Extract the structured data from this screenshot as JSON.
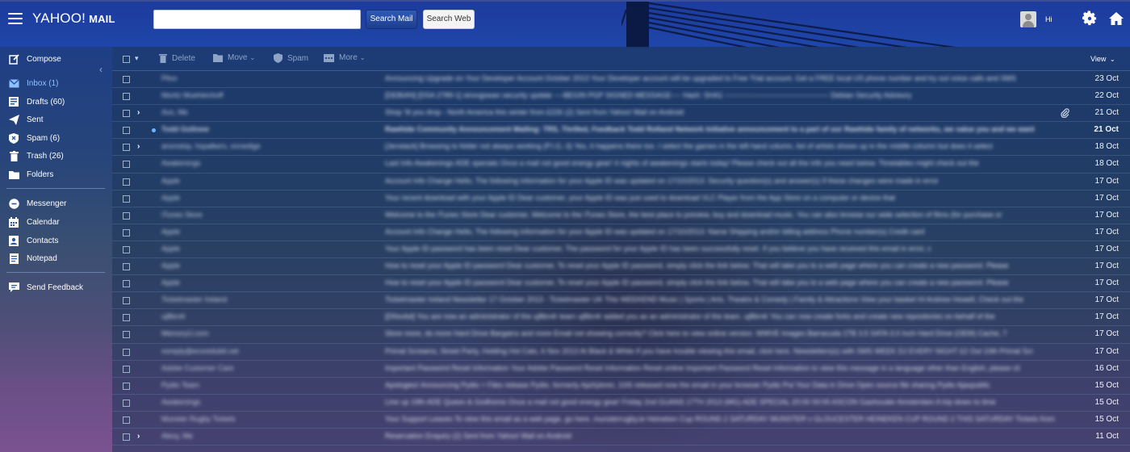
{
  "header": {
    "logo_main": "YAHOO!",
    "logo_sub": "MAIL",
    "search_value": "",
    "search_mail_label": "Search Mail",
    "search_web_label": "Search Web",
    "greeting": "Hi"
  },
  "sidebar": {
    "items": [
      {
        "label": "Compose",
        "icon": "compose-icon"
      },
      {
        "label": "Inbox (1)",
        "icon": "inbox-icon"
      },
      {
        "label": "Drafts (60)",
        "icon": "drafts-icon"
      },
      {
        "label": "Sent",
        "icon": "sent-icon"
      },
      {
        "label": "Spam (6)",
        "icon": "spam-icon"
      },
      {
        "label": "Trash (26)",
        "icon": "trash-icon"
      },
      {
        "label": "Folders",
        "icon": "folder-icon"
      },
      {
        "label": "Messenger",
        "icon": "messenger-icon"
      },
      {
        "label": "Calendar",
        "icon": "calendar-icon"
      },
      {
        "label": "Contacts",
        "icon": "contacts-icon"
      },
      {
        "label": "Notepad",
        "icon": "notepad-icon"
      },
      {
        "label": "Send Feedback",
        "icon": "feedback-icon"
      }
    ]
  },
  "toolbar": {
    "delete_label": "Delete",
    "move_label": "Move",
    "spam_label": "Spam",
    "more_label": "More",
    "view_label": "View"
  },
  "messages": [
    {
      "sender": "Plivo",
      "subject": "Announcing Upgrade on Your Developer Account  October 2013 Your Developer account will be upgraded to Free Trial account. Get a FREE local US phone number and try out voice calls and SMS",
      "date": "23 Oct",
      "unread": false,
      "thread": false,
      "attachment": false,
      "new_dot": false
    },
    {
      "sender": "Moritz Muehlenhoff",
      "subject": "[DEBIAN] [DSA 2789-1] strongswan security update  ----BEGIN PGP SIGNED MESSAGE---- Hash: SHA1 ------------------------------------------- Debian Security Advisory",
      "date": "22 Oct",
      "unread": false,
      "thread": false,
      "attachment": false,
      "new_dot": false
    },
    {
      "sender": "Avo, Me",
      "subject": "Shop 'til you drop - North America this winter from £226 (2)  Sent from Yahoo! Mail on Android",
      "date": "21 Oct",
      "unread": false,
      "thread": true,
      "attachment": true,
      "new_dot": false
    },
    {
      "sender": "Todd Gollnew",
      "subject": "Rawhide Community Announcement Mailing: TRS, Thrilled, Feedback  Todd Rolland Network Initiative announcement to a part of our Rawhide family of networks, we value you and we want",
      "date": "21 Oct",
      "unread": true,
      "thread": false,
      "attachment": false,
      "new_dot": true
    },
    {
      "sender": "anonstop, hspalkers, onnedige",
      "subject": "[Jenstack] Browsing to folder not always working (P.I.G.-3)  Yes, it happens there too. I select the games in the left hand column, list of artists shows up in the middle column but does it select",
      "date": "18 Oct",
      "unread": false,
      "thread": true,
      "attachment": false,
      "new_dot": false
    },
    {
      "sender": "Awakenings",
      "subject": "Last Info Awakenings ADE specials  Once a mail not good energy gear! 4 nights of awakenings starts today! Please check out all the info you need below. Timetables might check out the",
      "date": "18 Oct",
      "unread": false,
      "thread": false,
      "attachment": false,
      "new_dot": false
    },
    {
      "sender": "Apple",
      "subject": "Account Info Change  Hello, The following information for your Apple ID was updated on 17/10/2013: Security question(s) and answer(s) If these changes were made in error",
      "date": "17 Oct",
      "unread": false,
      "thread": false,
      "attachment": false,
      "new_dot": false
    },
    {
      "sender": "Apple",
      "subject": "Your recent download with your Apple ID  Dear customer, your Apple ID was just used to download VLC Player from the App Store on a computer or device that",
      "date": "17 Oct",
      "unread": false,
      "thread": false,
      "attachment": false,
      "new_dot": false
    },
    {
      "sender": "iTunes Store",
      "subject": "Welcome to the iTunes Store  Dear customer, Welcome to the iTunes Store, the best place to preview, buy and download music. You can also browse our wide selection of films (for purchase or",
      "date": "17 Oct",
      "unread": false,
      "thread": false,
      "attachment": false,
      "new_dot": false
    },
    {
      "sender": "Apple",
      "subject": "Account Info Change  Hello, The following information for your Apple ID was updated on 17/10/2013: Name Shipping and/or billing address Phone number(s) Credit card",
      "date": "17 Oct",
      "unread": false,
      "thread": false,
      "attachment": false,
      "new_dot": false
    },
    {
      "sender": "Apple",
      "subject": "Your Apple ID password has been reset  Dear customer, The password for your Apple ID has been successfully reset. If you believe you have received this email in error, c",
      "date": "17 Oct",
      "unread": false,
      "thread": false,
      "attachment": false,
      "new_dot": false
    },
    {
      "sender": "Apple",
      "subject": "How to reset your Apple ID password  Dear customer, To reset your Apple ID password, simply click the link below. That will take you to a web page where you can create a new password. Please",
      "date": "17 Oct",
      "unread": false,
      "thread": false,
      "attachment": false,
      "new_dot": false
    },
    {
      "sender": "Apple",
      "subject": "How to reset your Apple ID password  Dear customer, To reset your Apple ID password, simply click the link below. That will take you to a web page where you can create a new password. Please",
      "date": "17 Oct",
      "unread": false,
      "thread": false,
      "attachment": false,
      "new_dot": false
    },
    {
      "sender": "Ticketmaster Ireland",
      "subject": "Ticketmaster Ireland Newsletter  17 October 2013 - Ticketmaster UK This WEEKEND Music | Sports | Arts, Theatre & Comedy | Family & Attractions View your basket Hi Andrew Howell, Check out the",
      "date": "17 Oct",
      "unread": false,
      "thread": false,
      "attachment": false,
      "new_dot": false
    },
    {
      "sender": "uj8bn4r",
      "subject": "[DNsvbd] You are now an administrator of the uj8bn4r team  uj8bn4r added you as an administrator of the team. uj8bn4r You can now create forks and create new repositories on behalf of the",
      "date": "17 Oct",
      "unread": false,
      "thread": false,
      "attachment": false,
      "new_dot": false
    },
    {
      "sender": "MemoryU.com",
      "subject": "Store more, do more  Hard Drive Bargains and more  Email not showing correctly? Click here to view online version. WWVE Images Barracuda 1TB 3.5 SATA 3.0 Inch Hard Drive (OEM) Cache, 7",
      "date": "17 Oct",
      "unread": false,
      "thread": false,
      "attachment": false,
      "new_dot": false
    },
    {
      "sender": "noreply@ecoredubit.net",
      "subject": "Primal Screams, Street Party, Holding Hot Cats, 6 Nov 2013 At Black & White  If you have trouble viewing this email, click here. Newsletters(s) with SMS WEEK DJ EVERY NIGHT  £2 Out 10th Primal Scr",
      "date": "17 Oct",
      "unread": false,
      "thread": false,
      "attachment": false,
      "new_dot": false
    },
    {
      "sender": "Adobe Customer Care",
      "subject": "Important Password Reset Information  Your Adobe Password Reset Information Reset online Important Password Reset Information to view this message in a language other than English, please cli",
      "date": "16 Oct",
      "unread": false,
      "thread": false,
      "attachment": false,
      "new_dot": false
    },
    {
      "sender": "Pydio Team",
      "subject": "Apologies! Announcing Pydio + Files release  Pydio, formerly AjaXplorer, 10/6 released now the email in your browser Pydio  Put Your Data in Drive Open source file sharing Pydio Ajaxpublic",
      "date": "15 Oct",
      "unread": false,
      "thread": false,
      "attachment": false,
      "new_dot": false
    },
    {
      "sender": "Awakenings",
      "subject": "Line up 19th ADE Queen & Godhome  Once a mail not good energy gear! Friday 2nd GUANS 17TH 2013 (MG)  ADE SPECIAL 20:00  00:00 ASCON Gashouder Amsterdam A trip down to time",
      "date": "15 Oct",
      "unread": false,
      "thread": false,
      "attachment": false,
      "new_dot": false
    },
    {
      "sender": "Munster Rugby Tickets",
      "subject": "Your Support Leaves  To view this email as a web page, go here. munsterrugby.ie  Heineken Cup ROUND 2 SATURDAY MUNSTER v GLOUCESTER HEINEKEN CUP ROUND 2 THIS SATURDAY Tickets from 20 EUR. That's Ib",
      "date": "15 Oct",
      "unread": false,
      "thread": false,
      "attachment": false,
      "new_dot": false
    },
    {
      "sender": "Alexy, Me",
      "subject": "Reservation Enquiry (2)  Sent from Yahoo! Mail on Android",
      "date": "11 Oct",
      "unread": false,
      "thread": true,
      "attachment": false,
      "new_dot": false
    }
  ]
}
